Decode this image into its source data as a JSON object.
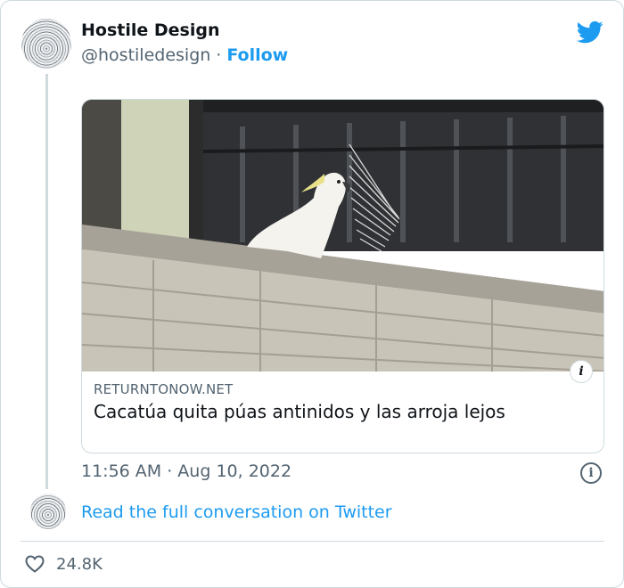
{
  "tweet": {
    "author_name": "Hostile Design",
    "handle": "@hostiledesign",
    "separator": "·",
    "follow_label": "Follow",
    "timestamp": "11:56 AM · Aug 10, 2022",
    "read_more_label": "Read the full conversation on Twitter",
    "like_count": "24.8K"
  },
  "link_card": {
    "domain": "RETURNTONOW.NET",
    "title": "Cacatúa quita púas antinidos y las arroja lejos",
    "info_badge": "i"
  },
  "icons": {
    "brand": "twitter-bird-icon",
    "info": "info-icon",
    "like": "heart-icon"
  },
  "colors": {
    "accent": "#1d9bf0",
    "text_primary": "#0f1419",
    "text_secondary": "#536471",
    "border": "#cfd9de"
  }
}
